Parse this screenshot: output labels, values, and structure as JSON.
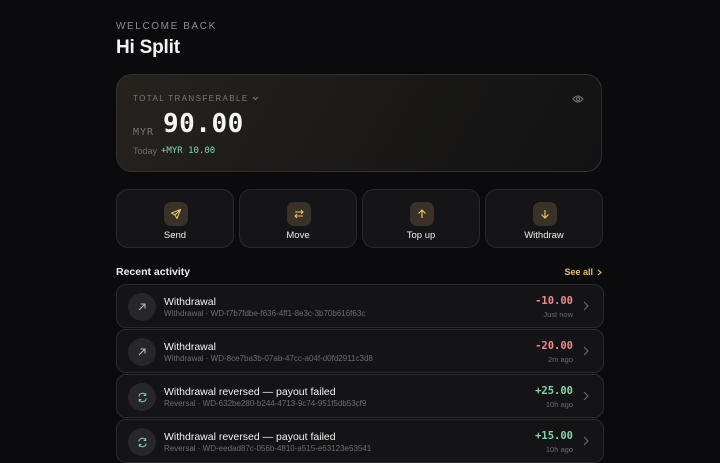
{
  "header": {
    "welcome": "WELCOME BACK",
    "title": "Hi Split"
  },
  "balance": {
    "label": "TOTAL TRANSFERABLE",
    "currency": "MYR",
    "amount": "90.00",
    "today_label": "Today",
    "today_delta": "+MYR 10.00",
    "icons": {
      "dropdown": "chevron-down-icon",
      "visibility": "eye-icon"
    }
  },
  "actions": [
    {
      "label": "Send",
      "icon": "send-icon"
    },
    {
      "label": "Move",
      "icon": "swap-icon"
    },
    {
      "label": "Top up",
      "icon": "arrow-up-icon"
    },
    {
      "label": "Withdraw",
      "icon": "arrow-down-icon"
    }
  ],
  "recent": {
    "title": "Recent activity",
    "see_all": "See all",
    "items": [
      {
        "title": "Withdrawal",
        "subtitle": "Withdrawal · WD-f7b7fdbe-f636-4ff1-8e3c-3b70b616f63c",
        "amount": "-10.00",
        "time": "Just now",
        "icon": "arrow-up-right-icon",
        "sign": "neg"
      },
      {
        "title": "Withdrawal",
        "subtitle": "Withdrawal · WD-8ce7ba3b-07ab-47cc-a04f-d0fd2911c3d8",
        "amount": "-20.00",
        "time": "2m ago",
        "icon": "arrow-up-right-icon",
        "sign": "neg"
      },
      {
        "title": "Withdrawal reversed — payout failed",
        "subtitle": "Reversal · WD-632be280-b244-4713-9c74-951f5db53cf9",
        "amount": "+25.00",
        "time": "10h ago",
        "icon": "refresh-icon",
        "sign": "pos"
      },
      {
        "title": "Withdrawal reversed — payout failed",
        "subtitle": "Reversal · WD-eedad87c-056b-4810-a515-e63123e53541",
        "amount": "+15.00",
        "time": "10h ago",
        "icon": "refresh-icon",
        "sign": "pos"
      }
    ]
  },
  "colors": {
    "background": "#0b0b0d",
    "accent": "#e8c35a",
    "positive": "#7fd6a6",
    "negative": "#f08a8a"
  }
}
